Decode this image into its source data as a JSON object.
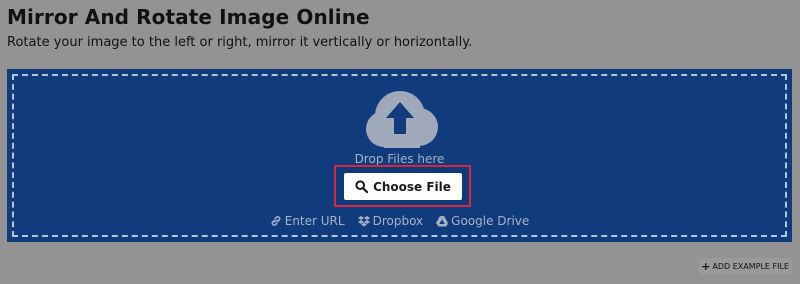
{
  "header": {
    "title": "Mirror And Rotate Image Online",
    "subtitle": "Rotate your image to the left or right, mirror it vertically or horizontally."
  },
  "upload": {
    "drop_text": "Drop Files here",
    "choose_label": "Choose File",
    "sources": [
      {
        "label": "Enter URL",
        "icon": "link-icon"
      },
      {
        "label": "Dropbox",
        "icon": "dropbox-icon"
      },
      {
        "label": "Google Drive",
        "icon": "google-drive-icon"
      }
    ]
  },
  "example": {
    "label": "ADD EXAMPLE FILE",
    "icon": "plus-icon"
  },
  "colors": {
    "page_background": "#939393",
    "upload_background": "#103c7e",
    "highlight_border": "#d9233f",
    "muted_text": "#a7b1c2"
  }
}
